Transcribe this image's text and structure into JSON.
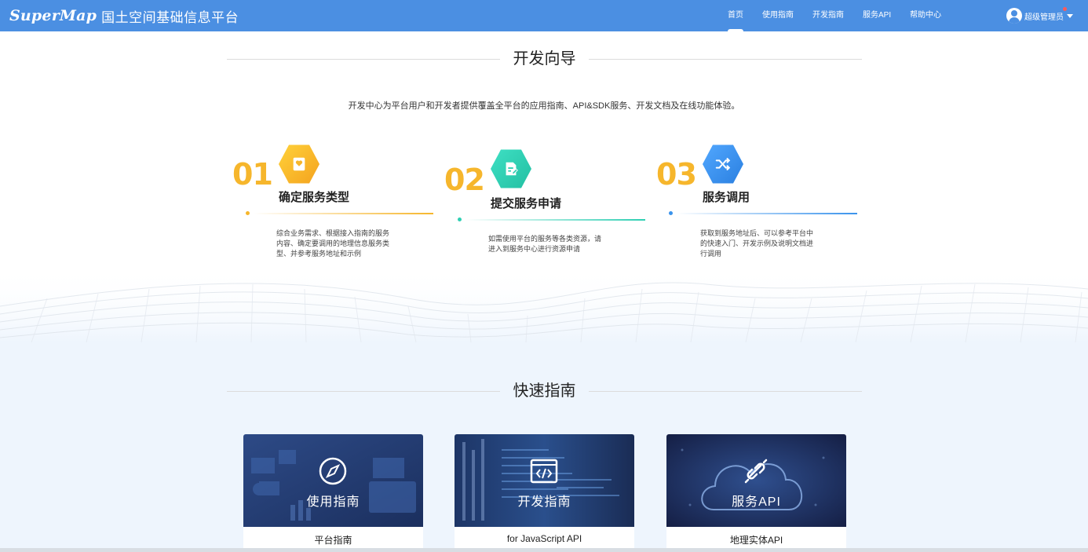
{
  "header": {
    "brand": "SuperMap",
    "title": "国土空间基础信息平台",
    "nav": [
      {
        "label": "首页",
        "active": true
      },
      {
        "label": "使用指南"
      },
      {
        "label": "开发指南"
      },
      {
        "label": "服务API"
      },
      {
        "label": "帮助中心"
      }
    ],
    "user": "超级管理员",
    "color": "#4b8fe2"
  },
  "dev_guide": {
    "title": "开发向导",
    "intro": "开发中心为平台用户和开发者提供覆盖全平台的应用指南、API&SDK服务、开发文档及在线功能体验。",
    "steps": [
      {
        "num": "01",
        "title": "确定服务类型",
        "desc": "综合业务需求、根据接入指南的服务内容、确定要调用的地理信息服务类型、并参考服务地址和示例",
        "color": "#f6b62c",
        "icon": "heart-bookmark-icon"
      },
      {
        "num": "02",
        "title": "提交服务申请",
        "desc": "如需使用平台的服务等各类资源，请进入到服务中心进行资源申请",
        "color": "#2fcfb3",
        "icon": "edit-document-icon"
      },
      {
        "num": "03",
        "title": "服务调用",
        "desc": "获取到服务地址后、可以参考平台中的快速入门、开发示例及说明文档进行调用",
        "color": "#3a93ec",
        "icon": "shuffle-icon"
      }
    ]
  },
  "quick_guide": {
    "title": "快速指南",
    "cards": [
      {
        "image_title": "使用指南",
        "caption": "平台指南",
        "icon": "compass-icon"
      },
      {
        "image_title": "开发指南",
        "caption": "for JavaScript API",
        "icon": "code-window-icon"
      },
      {
        "image_title": "服务API",
        "caption": "地理实体API",
        "icon": "cloud-plug-icon"
      }
    ]
  }
}
